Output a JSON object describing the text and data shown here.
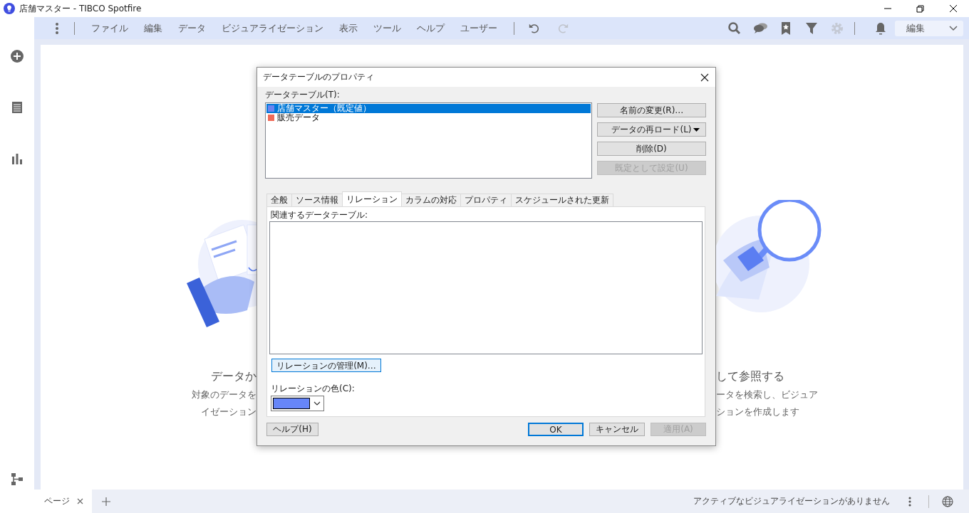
{
  "window": {
    "title": "店舗マスター - TIBCO Spotfire"
  },
  "menu": [
    "ファイル",
    "編集",
    "データ",
    "ビジュアライゼーション",
    "表示",
    "ツール",
    "ヘルプ",
    "ユーザー"
  ],
  "history_tools": [
    {
      "kind": "undo",
      "disabled": false
    },
    {
      "kind": "redo",
      "disabled": true
    }
  ],
  "toolbar_icons": [
    {
      "kind": "search",
      "disabled": false
    },
    {
      "kind": "chat",
      "disabled": false
    },
    {
      "kind": "bookmark",
      "disabled": false
    },
    {
      "kind": "filter",
      "disabled": false
    },
    {
      "kind": "settings",
      "disabled": true
    },
    {
      "kind": "notifications",
      "disabled": false
    }
  ],
  "mode_dropdown": {
    "value": "編集"
  },
  "sidebar": [
    {
      "kind": "add"
    },
    {
      "kind": "data"
    },
    {
      "kind": "chart"
    },
    {
      "kind": "flow"
    }
  ],
  "background_cards": [
    {
      "heading": "データか",
      "lines": [
        "対象のデータを",
        "イゼーション"
      ]
    },
    {
      "heading": "して参照する",
      "lines": [
        "ータを検索し、ビジュア",
        "ションを作成します"
      ]
    }
  ],
  "dialog": {
    "title": "データテーブルのプロパティ",
    "tables_label": "データテーブル(T):",
    "tables": [
      {
        "name": "店舗マスター（既定値）",
        "color": "#6b84f0",
        "selected": true
      },
      {
        "name": "販売データ",
        "color": "#f06a58",
        "selected": false
      }
    ],
    "side_buttons": [
      {
        "label": "名前の変更(R)…",
        "disabled": false,
        "dropdown": false
      },
      {
        "label": "データの再ロード(L)",
        "disabled": false,
        "dropdown": true
      },
      {
        "label": "削除(D)",
        "disabled": false,
        "dropdown": false
      },
      {
        "label": "既定として設定(U)",
        "disabled": true,
        "dropdown": false
      }
    ],
    "tabs": [
      {
        "label": "全般",
        "selected": false
      },
      {
        "label": "ソース情報",
        "selected": false
      },
      {
        "label": "リレーション",
        "selected": true
      },
      {
        "label": "カラムの対応",
        "selected": false
      },
      {
        "label": "プロパティ",
        "selected": false
      },
      {
        "label": "スケジュールされた更新",
        "selected": false
      }
    ],
    "related_label": "関連するデータテーブル:",
    "manage_button": "リレーションの管理(M)…",
    "color_label": "リレーションの色(C):",
    "color_picker": {
      "color": "#6786f8"
    },
    "buttons": [
      {
        "label": "ヘルプ(H)",
        "kind": "help",
        "default": false,
        "disabled": false
      },
      {
        "label": "OK",
        "kind": "action",
        "default": true,
        "disabled": false
      },
      {
        "label": "キャンセル",
        "kind": "action",
        "default": false,
        "disabled": false
      },
      {
        "label": "適用(A)",
        "kind": "action",
        "default": false,
        "disabled": true
      }
    ]
  },
  "status_bar": {
    "page_tabs": [
      {
        "label": "ページ",
        "selected": true
      }
    ],
    "message": "アクティブなビジュアライゼーションがありません"
  }
}
